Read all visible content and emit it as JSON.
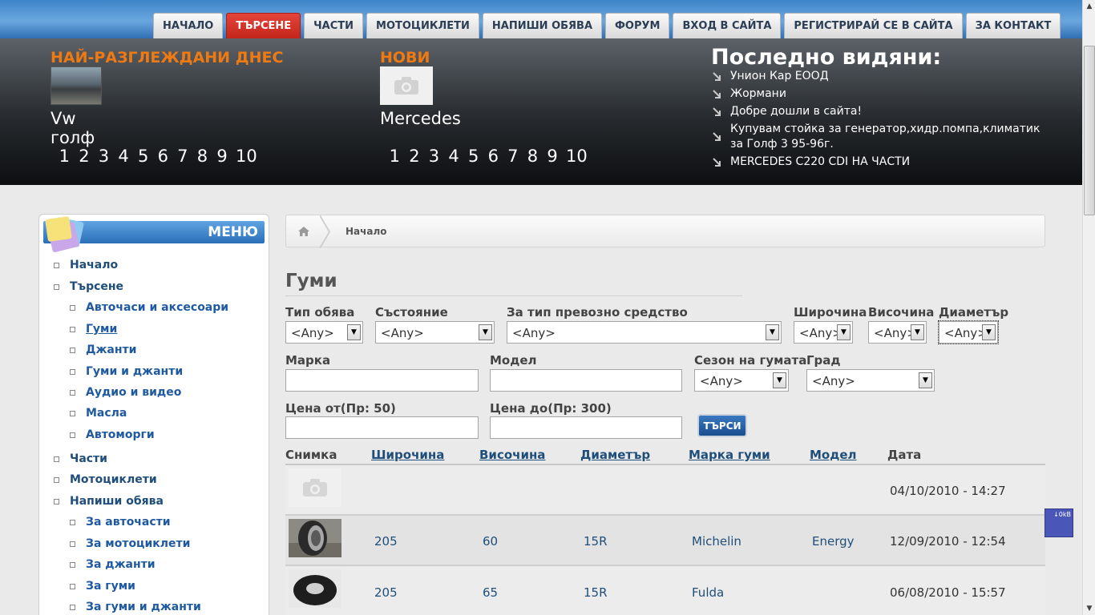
{
  "nav": [
    {
      "label": "НАЧАЛО",
      "active": false
    },
    {
      "label": "ТЪРСЕНЕ",
      "active": true
    },
    {
      "label": "ЧАСТИ",
      "active": false
    },
    {
      "label": "МОТОЦИКЛЕТИ",
      "active": false
    },
    {
      "label": "НАПИШИ ОБЯВА",
      "active": false
    },
    {
      "label": "ФОРУМ",
      "active": false
    },
    {
      "label": "ВХОД В САЙТА",
      "active": false
    },
    {
      "label": "РЕГИСТРИРАЙ СЕ В САЙТА",
      "active": false
    },
    {
      "label": "ЗА КОНТАКТ",
      "active": false
    }
  ],
  "header": {
    "most_viewed": {
      "title": "НАЙ-РАЗГЛЕЖДАНИ ДНЕС",
      "item_name": "Vw голф",
      "pages": [
        "1",
        "2",
        "3",
        "4",
        "5",
        "6",
        "7",
        "8",
        "9",
        "10"
      ]
    },
    "new": {
      "title": "НОВИ",
      "item_name": "Mercedes",
      "pages": [
        "1",
        "2",
        "3",
        "4",
        "5",
        "6",
        "7",
        "8",
        "9",
        "10"
      ]
    },
    "last_seen": {
      "title": "Последно видяни:",
      "items": [
        "Унион Кар ЕООД",
        "Жормани",
        "Добре дошли в сайта!",
        "Купувам стойка за генератор,хидр.помпа,климатик за Голф 3 95-96г.",
        "MERCEDES C220 CDI НА ЧАСТИ"
      ]
    }
  },
  "sidebar": {
    "title": "МЕНЮ",
    "items": [
      {
        "label": "Начало",
        "level": 0
      },
      {
        "label": "Търсене",
        "level": 0
      },
      {
        "label": "Авточаси и аксесоари",
        "level": 1
      },
      {
        "label": "Гуми",
        "level": 1,
        "current": true
      },
      {
        "label": "Джанти",
        "level": 1
      },
      {
        "label": "Гуми и джанти",
        "level": 1
      },
      {
        "label": "Аудио и видео",
        "level": 1
      },
      {
        "label": "Масла",
        "level": 1
      },
      {
        "label": "Автоморги",
        "level": 1
      },
      {
        "label": "Части",
        "level": 0
      },
      {
        "label": "Мотоциклети",
        "level": 0
      },
      {
        "label": "Напиши обява",
        "level": 0
      },
      {
        "label": "За авточасти",
        "level": 1
      },
      {
        "label": "За мотоциклети",
        "level": 1
      },
      {
        "label": "За джанти",
        "level": 1
      },
      {
        "label": "За гуми",
        "level": 1
      },
      {
        "label": "За гуми и джанти",
        "level": 1
      }
    ]
  },
  "breadcrumb": {
    "current": "Начало"
  },
  "main": {
    "title": "Гуми",
    "filters": {
      "ad_type": {
        "label": "Тип обява",
        "value": "<Any>"
      },
      "condition": {
        "label": "Състояние",
        "value": "<Any>"
      },
      "vehicle_type": {
        "label": "За тип превозно средство",
        "value": "<Any>"
      },
      "width": {
        "label": "Широчина",
        "value": "<Any>"
      },
      "height": {
        "label": "Височина",
        "value": "<Any>"
      },
      "diameter": {
        "label": "Диаметър",
        "value": "<Any>"
      },
      "brand": {
        "label": "Марка",
        "value": ""
      },
      "model": {
        "label": "Модел",
        "value": ""
      },
      "season": {
        "label": "Сезон на гумата",
        "value": "<Any>"
      },
      "city": {
        "label": "Град",
        "value": "<Any>"
      },
      "price_from": {
        "label": "Цена от(Пр: 50)",
        "value": ""
      },
      "price_to": {
        "label": "Цена до(Пр: 300)",
        "value": ""
      }
    },
    "search_button": "ТЪРСИ",
    "table": {
      "columns": [
        "Снимка",
        "Широчина",
        "Височина",
        "Диаметър",
        "Марка гуми",
        "Модел",
        "Дата"
      ],
      "rows": [
        {
          "photo": "placeholder",
          "width": "",
          "height": "",
          "diameter": "",
          "brand": "",
          "model": "",
          "date": "04/10/2010 - 14:27"
        },
        {
          "photo": "tire-photo",
          "width": "205",
          "height": "60",
          "diameter": "15R",
          "brand": "Michelin",
          "model": "Energy",
          "date": "12/09/2010 - 12:54"
        },
        {
          "photo": "tire-photo",
          "width": "205",
          "height": "65",
          "diameter": "15R",
          "brand": "Fulda",
          "model": "",
          "date": "06/08/2010 - 15:57"
        }
      ]
    }
  },
  "badge": "↓0kB",
  "colors": {
    "nav_active": "#d13a2e",
    "accent_orange": "#f07a12",
    "link_blue": "#1f4e7a",
    "button_blue": "#2a62a8"
  }
}
